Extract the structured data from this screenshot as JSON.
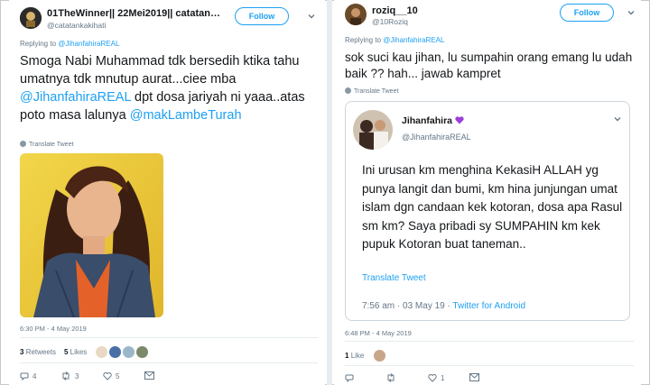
{
  "left_tweet": {
    "author_name": "01TheWinner|| 22Mei2019|| catatan…",
    "author_handle": "@catatankakihati",
    "follow_label": "Follow",
    "reply_prefix": "Replying to ",
    "reply_mention": "@JihanfahiraREAL",
    "text_part1": "Smoga Nabi Muhammad tdk bersedih ktika tahu umatnya tdk mnutup aurat...ciee mba ",
    "text_mention1": "@JihanfahiraREAL",
    "text_part2": " dpt dosa jariyah ni yaaa..atas poto masa lalunya ",
    "text_mention2": "@makLambeTurah",
    "translate_label": "Translate Tweet",
    "timestamp": "6:30 PM - 4 May 2019",
    "retweets_count": "3",
    "retweets_label": "Retweets",
    "likes_count": "5",
    "likes_label": "Likes",
    "actions": {
      "replies": "4",
      "retweets": "3",
      "likes": "5"
    }
  },
  "right_tweet": {
    "author_name": "roziq__10",
    "author_handle": "@10Roziq",
    "follow_label": "Follow",
    "reply_prefix": "Replying to ",
    "reply_mention": "@JihanfahiraREAL",
    "text": "sok suci kau jihan, lu sumpahin orang emang lu udah baik ?? hah... jawab kampret",
    "translate_label": "Translate Tweet",
    "timestamp": "6:48 PM - 4 May 2019",
    "likes_count": "1",
    "likes_label": "Like",
    "actions": {
      "likes": "1"
    },
    "quoted": {
      "author_name": "Jihanfahira",
      "author_handle": "@JihanfahiraREAL",
      "text": "Ini urusan km menghina KekasiH ALLAH yg punya langit dan bumi, km hina junjungan umat islam dgn candaan kek kotoran, dosa apa Rasul sm km? Saya pribadi sy SUMPAHIN km kek pupuk Kotoran buat taneman..",
      "translate_label": "Translate Tweet",
      "time": "7:56 am · 03 May 19 · ",
      "source": "Twitter for Android"
    }
  },
  "colors": {
    "accent": "#1da1f2",
    "muted": "#657786",
    "text": "#14171a",
    "border": "#e6ecf0",
    "heart": "#9b3fd6"
  }
}
